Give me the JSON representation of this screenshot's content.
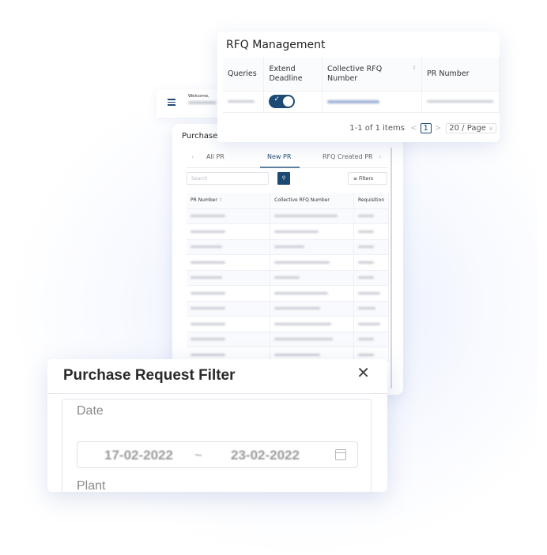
{
  "header": {
    "welcome_label": "Welcome,"
  },
  "purchase_card": {
    "title": "Purchase",
    "tabs": [
      {
        "label": "All PR",
        "active": false
      },
      {
        "label": "New PR",
        "active": true
      },
      {
        "label": "RFQ Created PR",
        "active": false
      }
    ],
    "search_placeholder": "Search",
    "search_icon": "search-icon",
    "filters_label": "Filters",
    "columns": [
      "PR Number",
      "Collective RFQ Number",
      "Requisition"
    ],
    "row_count": 10
  },
  "rfq_card": {
    "title": "RFQ Management",
    "columns": [
      "Queries",
      "Extend Deadline",
      "Collective RFQ Number",
      "PR Number"
    ],
    "row": {
      "extend_deadline_enabled": true
    },
    "pagination": {
      "summary": "1-1 of 1 items",
      "current_page": "1",
      "page_size": "20 / Page"
    }
  },
  "filter_panel": {
    "title": "Purchase Request Filter",
    "date_label": "Date",
    "date_from": "17-02-2022",
    "date_separator": "~",
    "date_to": "23-02-2022",
    "plant_label": "Plant"
  },
  "colors": {
    "accent": "#1d4a74",
    "tab_underline": "#5f7f9e"
  }
}
